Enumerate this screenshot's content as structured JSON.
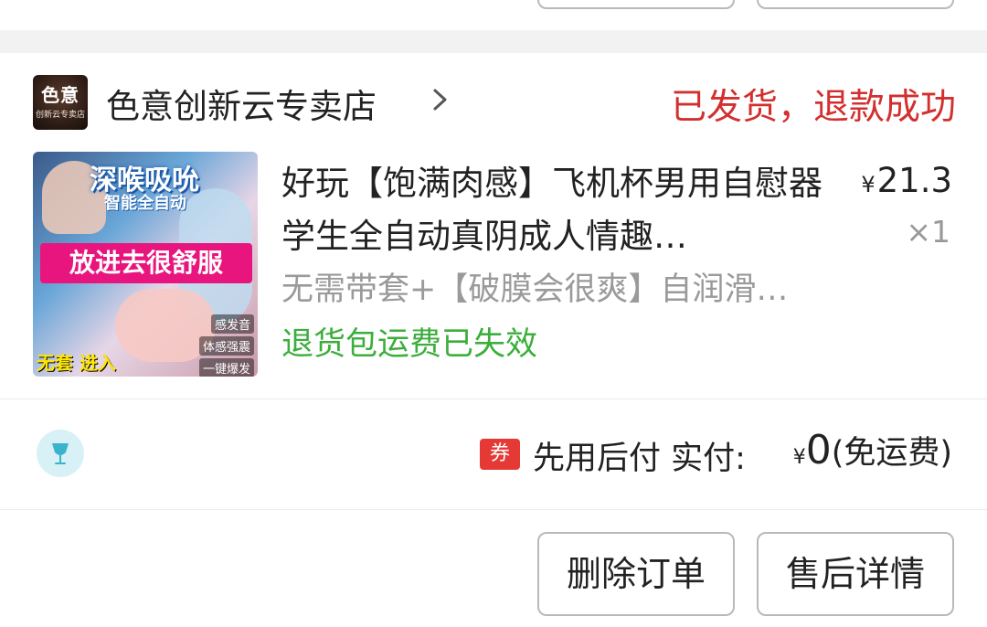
{
  "shop": {
    "logo_line1": "色意",
    "logo_line2": "创新云专卖店",
    "name": "色意创新云专卖店",
    "chevron_icon": "chevron-right-icon",
    "status": "已发货，退款成功",
    "status_color": "#d32f2f"
  },
  "product": {
    "image": {
      "banner1": "深喉吸吮",
      "banner2": "智能全自动",
      "pink_text": "放进去很舒服",
      "tag1": "感发音",
      "tag2": "体感强震",
      "tag3": "一键爆发",
      "bottom_text": "无套 进入"
    },
    "title": "好玩【饱满肉感】飞机杯男用自慰器学生全自动真阴成人情趣…",
    "price_symbol": "¥",
    "price": "21.3",
    "quantity": "×1",
    "spec": "无需带套+【破膜会很爽】自润滑…",
    "return_note": "退货包运费已失效",
    "return_note_color": "#3cae3c"
  },
  "payment": {
    "badge_icon": "wine-glass-icon",
    "coupon_label": "券",
    "method": "先用后付 实付:",
    "amount_symbol": "¥",
    "amount": "0",
    "shipping_note": "(免运费)"
  },
  "actions": {
    "delete_label": "删除订单",
    "after_sales_label": "售后详情"
  }
}
